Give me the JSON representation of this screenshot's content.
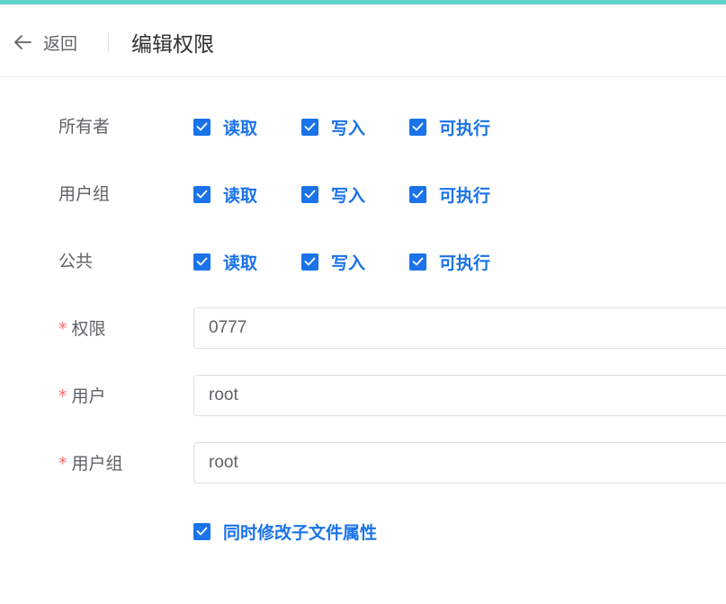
{
  "header": {
    "back_label": "返回",
    "title": "编辑权限"
  },
  "permissions": [
    {
      "label": "所有者",
      "options": [
        {
          "label": "读取",
          "checked": true
        },
        {
          "label": "写入",
          "checked": true
        },
        {
          "label": "可执行",
          "checked": true
        }
      ]
    },
    {
      "label": "用户组",
      "options": [
        {
          "label": "读取",
          "checked": true
        },
        {
          "label": "写入",
          "checked": true
        },
        {
          "label": "可执行",
          "checked": true
        }
      ]
    },
    {
      "label": "公共",
      "options": [
        {
          "label": "读取",
          "checked": true
        },
        {
          "label": "写入",
          "checked": true
        },
        {
          "label": "可执行",
          "checked": true
        }
      ]
    }
  ],
  "fields": {
    "mode": {
      "label": "权限",
      "value": "0777",
      "required": true
    },
    "user": {
      "label": "用户",
      "value": "root",
      "required": true
    },
    "group": {
      "label": "用户组",
      "value": "root",
      "required": true
    }
  },
  "recursive": {
    "label": "同时修改子文件属性",
    "checked": true
  },
  "colors": {
    "accent_bar": "#5fd3c9",
    "primary": "#1a73e8",
    "required_star": "#f56c6c"
  },
  "icons": {
    "back": "arrow-left-icon",
    "check": "check-icon"
  }
}
